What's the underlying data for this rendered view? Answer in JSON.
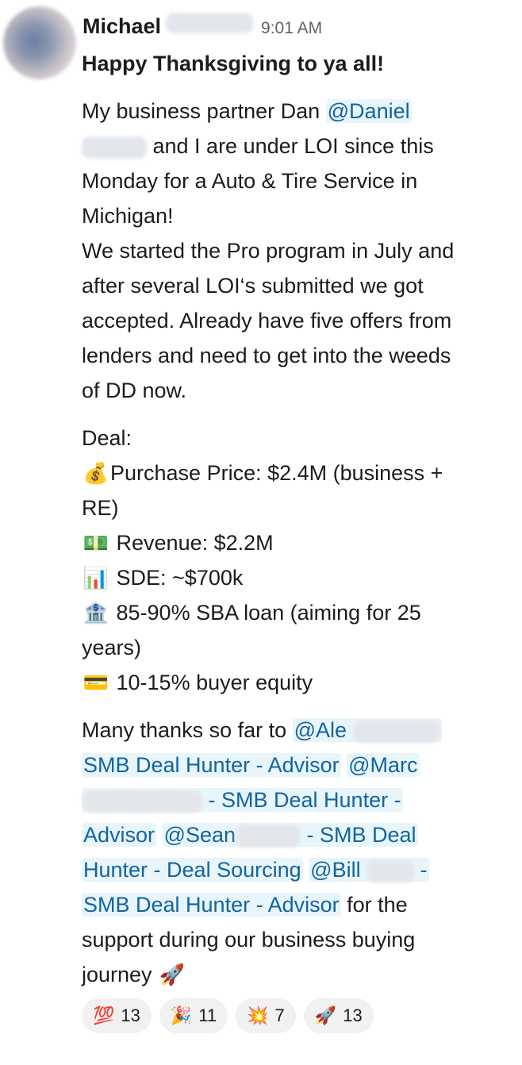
{
  "message": {
    "author": "Michael",
    "time": "9:01 AM",
    "title": "Happy Thanksgiving to ya all!",
    "intro": {
      "l1a": "My business partner Dan ",
      "mention_daniel": "@Daniel",
      "l2": " and I are under LOI since this",
      "l3": "Monday for a Auto & Tire Service in",
      "l4": "Michigan!",
      "l5": "We started the Pro program in July and",
      "l6": "after several LOI‘s submitted we got",
      "l7": "accepted. Already have five offers from",
      "l8": "lenders and need to get into the weeds",
      "l9": "of DD now."
    },
    "deal": {
      "heading": "Deal:",
      "price_icon": "money-bag-icon",
      "price_emoji": "💰",
      "price_a": "Purchase Price: $2.4M (business +",
      "price_b": "RE)",
      "revenue_icon": "dollar-banknote-icon",
      "revenue_emoji": "💵",
      "revenue": "Revenue: $2.2M",
      "sde_icon": "bar-chart-icon",
      "sde_emoji": "📊",
      "sde": "SDE: ~$700k",
      "loan_icon": "bank-icon",
      "loan_emoji": "🏦",
      "loan_a": "85-90% SBA loan (aiming for 25",
      "loan_b": "years)",
      "equity_icon": "credit-card-icon",
      "equity_emoji": "💳",
      "equity": "10-15% buyer equity"
    },
    "thanks": {
      "lead": "Many thanks so far to ",
      "m_ale": "@Ale",
      "m_ale_role": "SMB Deal Hunter - Advisor",
      "m_marc": "@Marc",
      "m_marc_role_a": " - SMB Deal Hunter -",
      "m_marc_role_b": "Advisor",
      "m_sean": "@Sean",
      "m_sean_role_a": " - SMB Deal",
      "m_sean_role_b": "Hunter - Deal Sourcing",
      "m_bill": "@Bill",
      "m_bill_role_a": " -",
      "m_bill_role_b": "SMB Deal Hunter - Advisor",
      "tail_a": " for the",
      "tail_b": "support during our business buying",
      "tail_c": "journey",
      "rocket_emoji": "🚀"
    }
  },
  "reactions": [
    {
      "icon": "hundred-points-icon",
      "emoji": "💯",
      "count": "13"
    },
    {
      "icon": "party-popper-icon",
      "emoji": "🎉",
      "count": "11"
    },
    {
      "icon": "collision-icon",
      "emoji": "💥",
      "count": "7"
    },
    {
      "icon": "rocket-icon",
      "emoji": "🚀",
      "count": "13"
    }
  ]
}
